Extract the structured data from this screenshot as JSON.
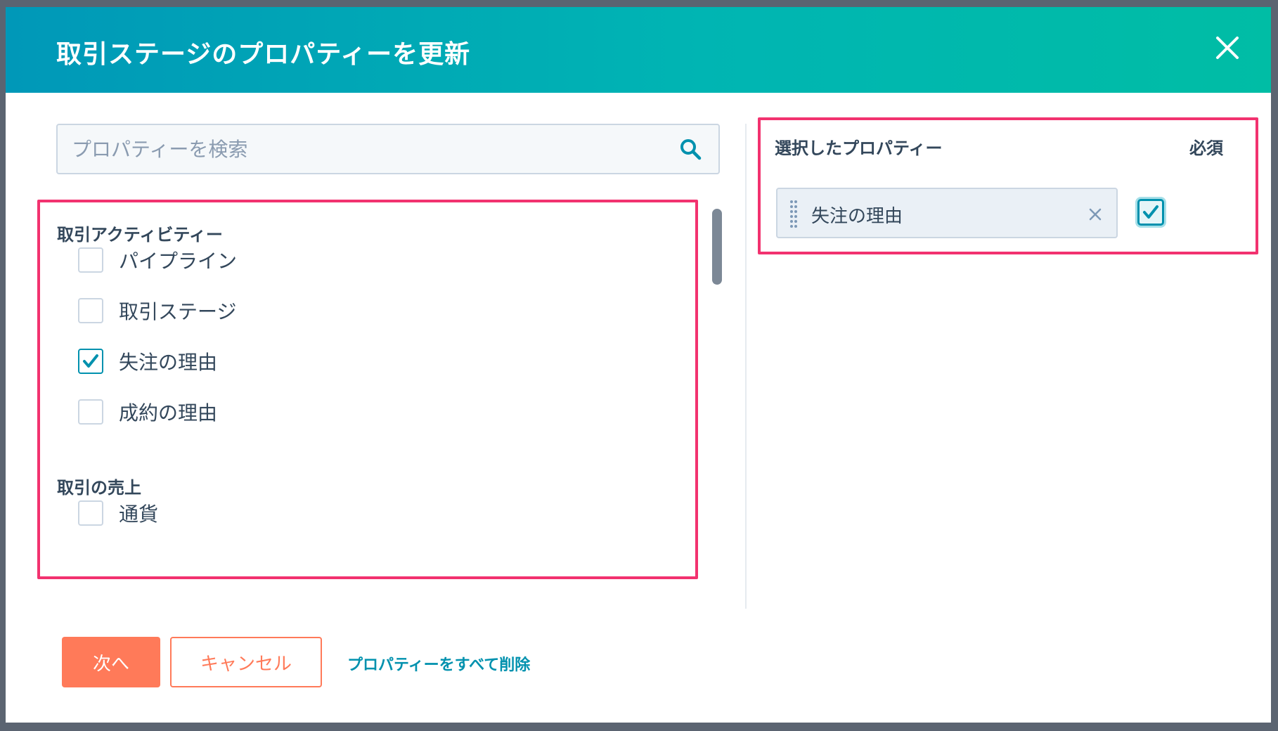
{
  "dialog": {
    "title": "取引ステージのプロパティーを更新",
    "close_icon": "close-icon"
  },
  "search": {
    "placeholder": "プロパティーを検索",
    "value": "",
    "icon": "search-icon"
  },
  "groups": [
    {
      "title": "取引アクティビティー",
      "options": [
        {
          "label": "パイプライン",
          "checked": false
        },
        {
          "label": "取引ステージ",
          "checked": false
        },
        {
          "label": "失注の理由",
          "checked": true
        },
        {
          "label": "成約の理由",
          "checked": false
        }
      ]
    },
    {
      "title": "取引の売上",
      "options": [
        {
          "label": "通貨",
          "checked": false
        }
      ]
    }
  ],
  "selected": {
    "title": "選択したプロパティー",
    "required_header": "必須",
    "items": [
      {
        "label": "失注の理由",
        "required": true
      }
    ]
  },
  "footer": {
    "next_label": "次へ",
    "cancel_label": "キャンセル",
    "remove_all_label": "プロパティーをすべて削除"
  },
  "colors": {
    "accent": "#0091ae",
    "primary_button": "#ff7a59",
    "highlight_border": "#f2326f",
    "header_gradient_start": "#0098b8",
    "header_gradient_end": "#00bda5"
  }
}
